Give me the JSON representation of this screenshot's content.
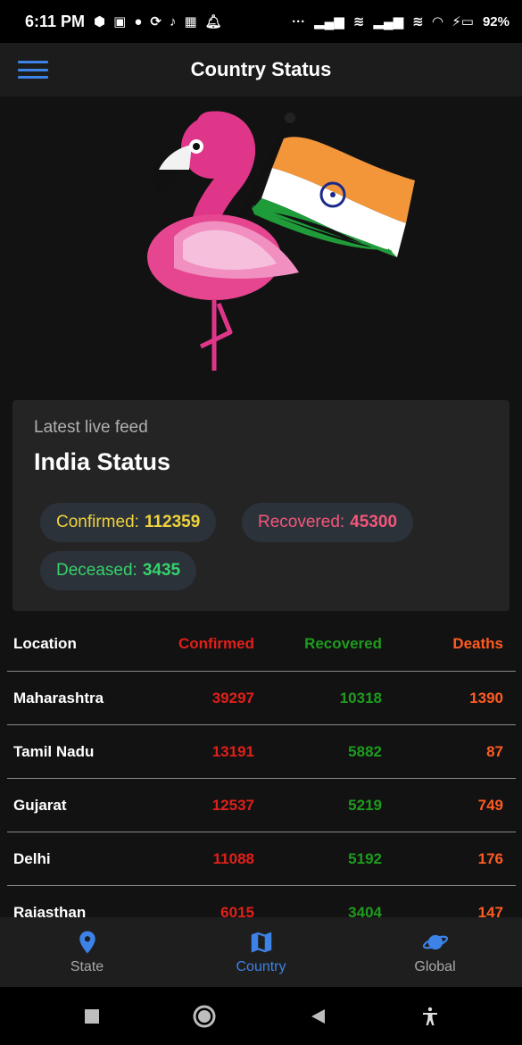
{
  "status_bar": {
    "time": "6:11 PM",
    "left_icons": [
      "bolt-icon",
      "card-icon",
      "jio-icon",
      "sync-icon",
      "tiktok-icon",
      "grid-icon",
      "bell-icon"
    ],
    "battery": "92%"
  },
  "app_bar": {
    "title": "Country Status"
  },
  "hero": {
    "image": "flamingo-with-india-flag"
  },
  "card": {
    "subtitle": "Latest live feed",
    "title": "India Status",
    "confirmed_label": "Confirmed:",
    "confirmed_value": "112359",
    "recovered_label": "Recovered:",
    "recovered_value": "45300",
    "deceased_label": "Deceased:",
    "deceased_value": "3435"
  },
  "table": {
    "headers": {
      "location": "Location",
      "confirmed": "Confirmed",
      "recovered": "Recovered",
      "deaths": "Deaths"
    },
    "rows": [
      {
        "location": "Maharashtra",
        "confirmed": "39297",
        "recovered": "10318",
        "deaths": "1390"
      },
      {
        "location": "Tamil Nadu",
        "confirmed": "13191",
        "recovered": "5882",
        "deaths": "87"
      },
      {
        "location": "Gujarat",
        "confirmed": "12537",
        "recovered": "5219",
        "deaths": "749"
      },
      {
        "location": "Delhi",
        "confirmed": "11088",
        "recovered": "5192",
        "deaths": "176"
      },
      {
        "location": "Rajasthan",
        "confirmed": "6015",
        "recovered": "3404",
        "deaths": "147"
      }
    ]
  },
  "bottom_nav": {
    "items": [
      {
        "label": "State",
        "icon": "location-pin-icon",
        "active": false
      },
      {
        "label": "Country",
        "icon": "map-icon",
        "active": true
      },
      {
        "label": "Global",
        "icon": "planet-icon",
        "active": false
      }
    ]
  },
  "colors": {
    "accent": "#3d82e6",
    "confirmed": "#e0201a",
    "recovered": "#1e9b1e",
    "deaths": "#ff5b22"
  }
}
